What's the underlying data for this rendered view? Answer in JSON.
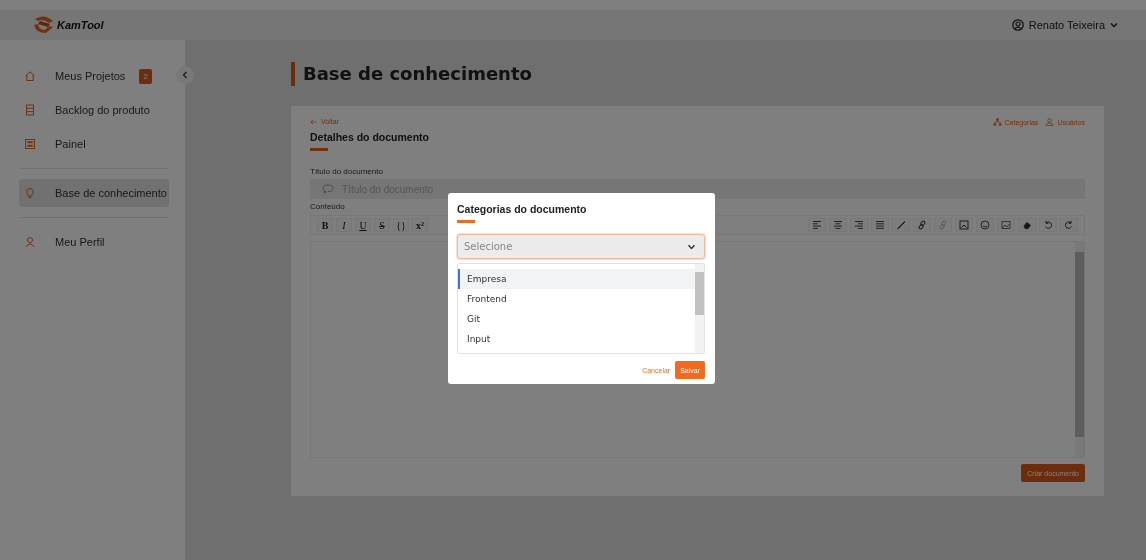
{
  "header": {
    "logo_text": "KamTool",
    "user_name": "Renato Teixeira"
  },
  "sidebar": {
    "sections": [
      [
        {
          "label": "Meus Projetos",
          "badge": "2",
          "selected": false
        },
        {
          "label": "Backlog do produto",
          "selected": false
        },
        {
          "label": "Painel",
          "selected": false
        }
      ],
      [
        {
          "label": "Base de conhecimento",
          "selected": true
        }
      ],
      [
        {
          "label": "Meu Perfil",
          "selected": false
        }
      ]
    ]
  },
  "page_title": "Base de conhecimento",
  "card": {
    "back_link": "Voltar",
    "heading": "Detalhes do documento",
    "actions": [
      "Categorias",
      "Usuários"
    ],
    "title_field": {
      "label": "Título do documento",
      "placeholder": "Título do documento"
    },
    "content_label": "Conteúdo",
    "toolbar": {
      "text_buttons": [
        "B",
        "I",
        "U",
        "S",
        "{}",
        "x²"
      ],
      "icon_buttons": [
        {
          "disabled": false
        },
        {
          "disabled": false
        },
        {
          "disabled": false
        },
        {
          "disabled": false
        },
        {
          "disabled": false
        },
        {
          "disabled": false
        },
        {
          "disabled": true
        },
        {
          "disabled": false
        },
        {
          "disabled": false
        },
        {
          "disabled": false
        },
        {
          "disabled": false
        },
        {
          "disabled": false
        },
        {
          "disabled": false
        }
      ]
    },
    "submit": "Criar documento"
  },
  "modal": {
    "title": "Categorias do documento",
    "select_placeholder": "Selecione",
    "options": [
      {
        "label": "Empresa",
        "selected": true
      },
      {
        "label": "Frontend",
        "selected": false
      },
      {
        "label": "Git",
        "selected": false
      },
      {
        "label": "Input",
        "selected": false
      }
    ],
    "cancel": "Cancelar",
    "save": "Salvar"
  }
}
